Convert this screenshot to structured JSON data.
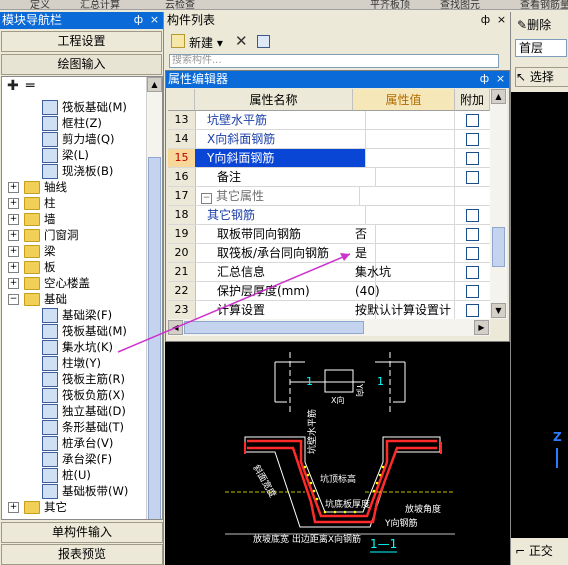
{
  "top_strip": {
    "items": [
      "定义",
      "汇总计算",
      "云检查",
      "平齐板顶",
      "查找图元",
      "查看钢筋量"
    ]
  },
  "nav": {
    "title": "模块导航栏",
    "pin": "ф",
    "close": "×",
    "top_buttons": [
      "工程设置",
      "绘图输入"
    ],
    "tree_leaves_top": [
      {
        "label": "筏板基础(M)",
        "icon": "raft-foundation-icon"
      },
      {
        "label": "框柱(Z)",
        "icon": "frame-column-icon"
      },
      {
        "label": "剪力墙(Q)",
        "icon": "shear-wall-icon"
      },
      {
        "label": "梁(L)",
        "icon": "beam-icon"
      },
      {
        "label": "现浇板(B)",
        "icon": "cast-slab-icon"
      }
    ],
    "tree_folders": [
      "轴线",
      "柱",
      "墙",
      "门窗洞",
      "梁",
      "板",
      "空心楼盖",
      "基础"
    ],
    "tree_foundation_items": [
      {
        "label": "基础梁(F)",
        "icon": "foundation-beam-icon"
      },
      {
        "label": "筏板基础(M)",
        "icon": "raft-foundation-icon"
      },
      {
        "label": "集水坑(K)",
        "icon": "sump-pit-icon"
      },
      {
        "label": "柱墩(Y)",
        "icon": "column-pier-icon"
      },
      {
        "label": "筏板主筋(R)",
        "icon": "raft-main-rebar-icon"
      },
      {
        "label": "筏板负筋(X)",
        "icon": "raft-negative-rebar-icon"
      },
      {
        "label": "独立基础(D)",
        "icon": "isolated-foundation-icon"
      },
      {
        "label": "条形基础(T)",
        "icon": "strip-foundation-icon"
      },
      {
        "label": "桩承台(V)",
        "icon": "pile-cap-icon"
      },
      {
        "label": "承台梁(F)",
        "icon": "cap-beam-icon"
      },
      {
        "label": "桩(U)",
        "icon": "pile-icon"
      },
      {
        "label": "基础板带(W)",
        "icon": "foundation-strip-icon"
      }
    ],
    "tree_folder_last": "其它",
    "bottom_buttons": [
      "单构件输入",
      "报表预览"
    ]
  },
  "component_list": {
    "title": "构件列表",
    "pin": "ф",
    "close": "×",
    "new_label": "新建",
    "search_placeholder": "搜索构件..."
  },
  "prop_editor": {
    "title": "属性编辑器",
    "pin": "ф",
    "close": "×",
    "headers": [
      "属性名称",
      "属性值",
      "附加"
    ],
    "rows": [
      {
        "num": "13",
        "name": "坑壁水平筋",
        "value": "",
        "style": "blue"
      },
      {
        "num": "14",
        "name": "X向斜面钢筋",
        "value": "",
        "style": "blue"
      },
      {
        "num": "15",
        "name": "Y向斜面钢筋",
        "value": "",
        "style": "selected"
      },
      {
        "num": "16",
        "name": "备注",
        "value": "",
        "style": "normal"
      },
      {
        "num": "17",
        "name": "其它属性",
        "value": "",
        "style": "group"
      },
      {
        "num": "18",
        "name": "其它钢筋",
        "value": "",
        "style": "blue"
      },
      {
        "num": "19",
        "name": "取板带同向钢筋",
        "value": "否",
        "style": "normal"
      },
      {
        "num": "20",
        "name": "取筏板/承台同向钢筋",
        "value": "是",
        "style": "normal"
      },
      {
        "num": "21",
        "name": "汇总信息",
        "value": "集水坑",
        "style": "normal"
      },
      {
        "num": "22",
        "name": "保护层厚度(mm)",
        "value": "(40)",
        "style": "normal"
      },
      {
        "num": "23",
        "name": "计算设置",
        "value": "按默认计算设置计",
        "style": "normal"
      }
    ]
  },
  "cad": {
    "labels": {
      "dim_1a": "1",
      "dim_1b": "1",
      "xdir": "X向",
      "ydir": "Y向",
      "wall_horiz": "坑壁水平筋",
      "pit_top": "坑顶标高",
      "slope_width": "斜面宽度",
      "bottom_thick": "坑底板厚度",
      "slope_angle": "放坡角度",
      "y_rebar": "Y向钢筋",
      "bottom_row": "放坡底宽 出边距离X向钢筋",
      "section": "1—1"
    }
  },
  "right_panel": {
    "delete_label": "删除",
    "floor_label": "首层",
    "select_label": "选择",
    "axis_label": "Z",
    "ortho_label": "正交"
  },
  "colors": {
    "titlebar": "#0a6ad8",
    "selected_row": "#0a46d6",
    "cad_bg": "#000000",
    "callout": "#cc33cc"
  }
}
